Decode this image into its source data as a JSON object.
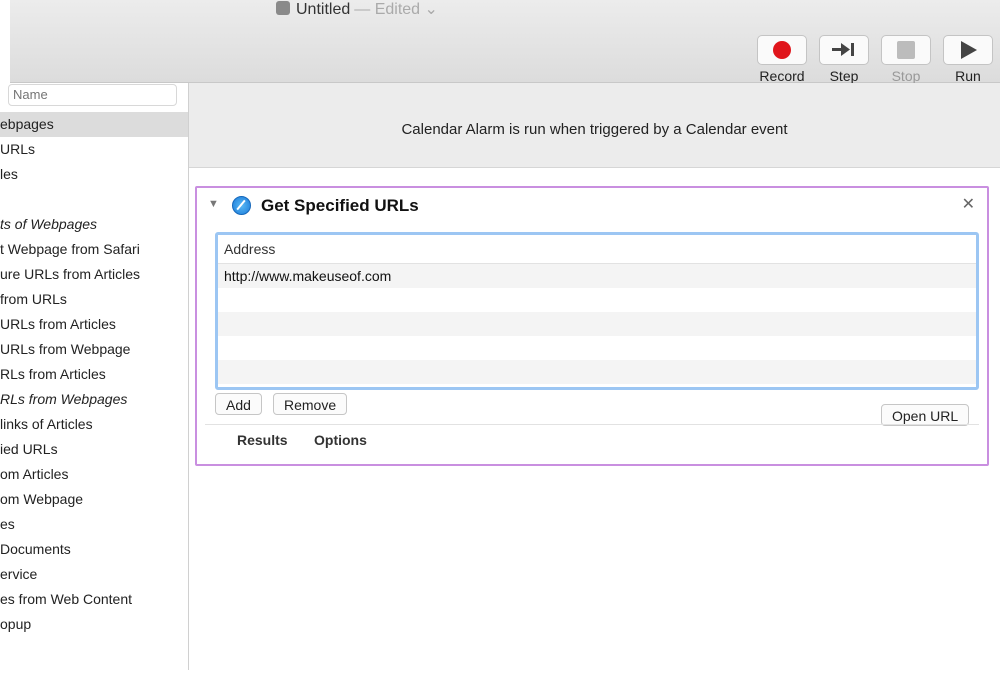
{
  "window": {
    "title": "Untitled",
    "edited": "— Edited ⌄"
  },
  "toolbar": {
    "record": "Record",
    "step": "Step",
    "stop": "Stop",
    "run": "Run",
    "record_color": "#e0151b"
  },
  "sidebar": {
    "search_placeholder": "Name",
    "items": [
      {
        "label": "ebpages"
      },
      {
        "label": "URLs"
      },
      {
        "label": "les"
      },
      {
        "label": ""
      },
      {
        "label": "ts of Webpages"
      },
      {
        "label": "t Webpage from Safari"
      },
      {
        "label": "ure URLs from Articles"
      },
      {
        "label": "from URLs"
      },
      {
        "label": "URLs from Articles"
      },
      {
        "label": "URLs from Webpage"
      },
      {
        "label": "RLs from Articles"
      },
      {
        "label": "RLs from Webpages"
      },
      {
        "label": "links of Articles"
      },
      {
        "label": "ied URLs"
      },
      {
        "label": "om Articles"
      },
      {
        "label": "om Webpage"
      },
      {
        "label": "es"
      },
      {
        "label": "Documents"
      },
      {
        "label": "ervice"
      },
      {
        "label": "es from Web Content"
      },
      {
        "label": "opup"
      }
    ]
  },
  "main": {
    "banner": "Calendar Alarm is run when triggered by a Calendar event",
    "action": {
      "title": "Get Specified URLs",
      "column_header": "Address",
      "rows": [
        "http://www.makeuseof.com",
        "",
        "",
        "",
        ""
      ],
      "add_label": "Add",
      "remove_label": "Remove",
      "open_url_label": "Open URL",
      "results_tab": "Results",
      "options_tab": "Options",
      "highlight_color": "#c98fe0"
    }
  }
}
